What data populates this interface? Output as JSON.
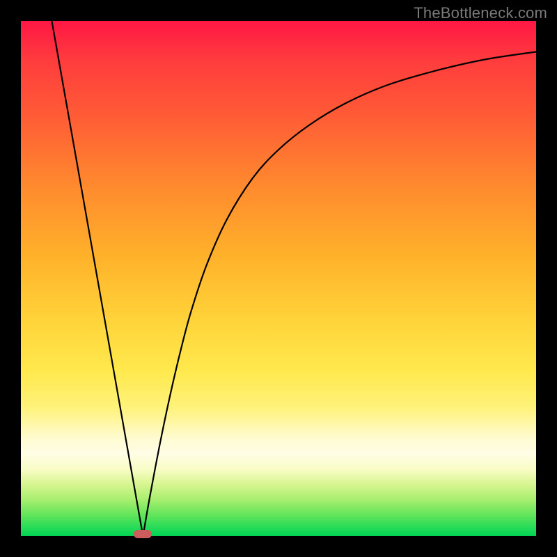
{
  "watermark": "TheBottleneck.com",
  "colors": {
    "frame_bg": "#000000",
    "curve": "#000000",
    "marker": "#cd5c5c",
    "gradient_top": "#ff1744",
    "gradient_bottom": "#00d154"
  },
  "chart_data": {
    "type": "line",
    "title": "",
    "xlabel": "",
    "ylabel": "",
    "xlim": [
      0,
      100
    ],
    "ylim": [
      0,
      100
    ],
    "grid": false,
    "legend": false,
    "series": [
      {
        "name": "left-branch",
        "x": [
          6,
          8,
          10,
          12,
          14,
          16,
          18,
          20,
          22,
          23.7
        ],
        "values": [
          100,
          88.7,
          77.4,
          66.1,
          54.8,
          43.5,
          32.2,
          20.9,
          9.6,
          0
        ]
      },
      {
        "name": "right-branch",
        "x": [
          23.7,
          25,
          27,
          29,
          31,
          33,
          36,
          40,
          45,
          50,
          56,
          63,
          71,
          80,
          90,
          100
        ],
        "values": [
          0,
          7.5,
          18.0,
          27.5,
          36.0,
          43.5,
          52.5,
          61.5,
          69.5,
          75.0,
          79.8,
          84.0,
          87.5,
          90.2,
          92.5,
          94.0
        ]
      }
    ],
    "annotations": [
      {
        "name": "minimum-marker",
        "x": 23.7,
        "y": 0
      }
    ]
  }
}
